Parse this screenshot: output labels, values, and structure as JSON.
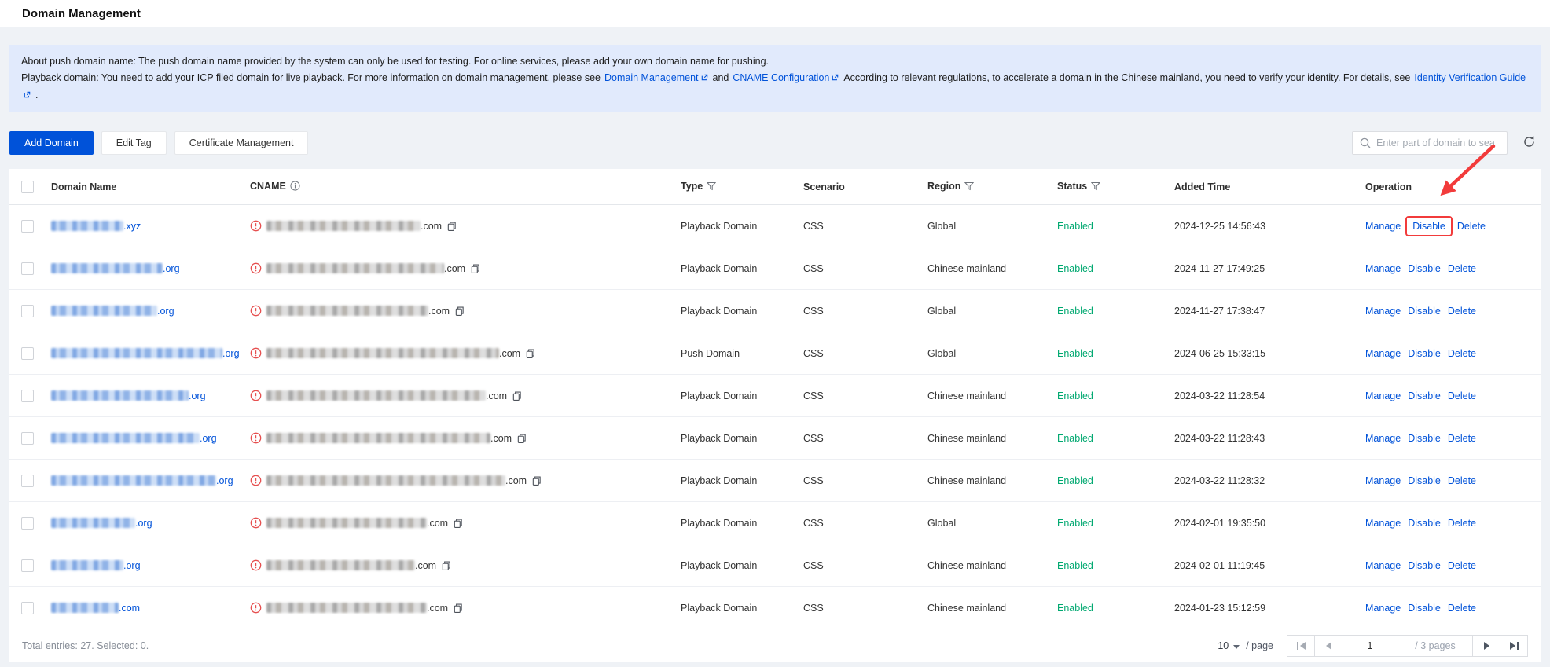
{
  "page_title": "Domain Management",
  "banner": {
    "line1": "About push domain name: The push domain name provided by the system can only be used for testing. For online services, please add your own domain name for pushing.",
    "line2_text1": "Playback domain: You need to add your ICP filed domain for live playback. For more information on domain management, please see",
    "line2_link1": "Domain Management",
    "line2_text2": "and",
    "line2_link2": "CNAME Configuration",
    "line2_text3": "According to relevant regulations, to accelerate a domain in the Chinese mainland, you need to verify your identity. For details, see",
    "line2_link3": "Identity Verification Guide",
    "line2_text4": "."
  },
  "toolbar": {
    "add_domain_label": "Add Domain",
    "edit_tag_label": "Edit Tag",
    "certificate_label": "Certificate Management",
    "search_placeholder": "Enter part of domain to sea"
  },
  "table": {
    "headers": {
      "domain": "Domain Name",
      "cname": "CNAME",
      "type": "Type",
      "scenario": "Scenario",
      "region": "Region",
      "status": "Status",
      "added": "Added Time",
      "operation": "Operation"
    },
    "op_labels": [
      "Manage",
      "Disable",
      "Delete"
    ],
    "status_color": "#00a870",
    "rows": [
      {
        "domain_suffix": ".xyz",
        "domain_blur_width": 92,
        "cname_suffix": ".com",
        "cname_blur_width": 196,
        "type": "Playback Domain",
        "scenario": "CSS",
        "region": "Global",
        "status": "Enabled",
        "added_time": "2024-12-25 14:56:43",
        "highlight_op": "Disable"
      },
      {
        "domain_suffix": ".org",
        "domain_blur_width": 142,
        "cname_suffix": ".com",
        "cname_blur_width": 226,
        "type": "Playback Domain",
        "scenario": "CSS",
        "region": "Chinese mainland",
        "status": "Enabled",
        "added_time": "2024-11-27 17:49:25",
        "highlight_op": null
      },
      {
        "domain_suffix": ".org",
        "domain_blur_width": 135,
        "cname_suffix": ".com",
        "cname_blur_width": 206,
        "type": "Playback Domain",
        "scenario": "CSS",
        "region": "Global",
        "status": "Enabled",
        "added_time": "2024-11-27 17:38:47",
        "highlight_op": null
      },
      {
        "domain_suffix": ".org",
        "domain_blur_width": 218,
        "cname_suffix": ".com",
        "cname_blur_width": 296,
        "type": "Push Domain",
        "scenario": "CSS",
        "region": "Global",
        "status": "Enabled",
        "added_time": "2024-06-25 15:33:15",
        "highlight_op": null
      },
      {
        "domain_suffix": ".org",
        "domain_blur_width": 175,
        "cname_suffix": ".com",
        "cname_blur_width": 279,
        "type": "Playback Domain",
        "scenario": "CSS",
        "region": "Chinese mainland",
        "status": "Enabled",
        "added_time": "2024-03-22 11:28:54",
        "highlight_op": null
      },
      {
        "domain_suffix": ".org",
        "domain_blur_width": 189,
        "cname_suffix": ".com",
        "cname_blur_width": 285,
        "type": "Playback Domain",
        "scenario": "CSS",
        "region": "Chinese mainland",
        "status": "Enabled",
        "added_time": "2024-03-22 11:28:43",
        "highlight_op": null
      },
      {
        "domain_suffix": ".org",
        "domain_blur_width": 210,
        "cname_suffix": ".com",
        "cname_blur_width": 304,
        "type": "Playback Domain",
        "scenario": "CSS",
        "region": "Chinese mainland",
        "status": "Enabled",
        "added_time": "2024-03-22 11:28:32",
        "highlight_op": null
      },
      {
        "domain_suffix": ".org",
        "domain_blur_width": 107,
        "cname_suffix": ".com",
        "cname_blur_width": 204,
        "type": "Playback Domain",
        "scenario": "CSS",
        "region": "Global",
        "status": "Enabled",
        "added_time": "2024-02-01 19:35:50",
        "highlight_op": null
      },
      {
        "domain_suffix": ".org",
        "domain_blur_width": 92,
        "cname_suffix": ".com",
        "cname_blur_width": 189,
        "type": "Playback Domain",
        "scenario": "CSS",
        "region": "Chinese mainland",
        "status": "Enabled",
        "added_time": "2024-02-01 11:19:45",
        "highlight_op": null
      },
      {
        "domain_suffix": ".com",
        "domain_blur_width": 86,
        "cname_suffix": ".com",
        "cname_blur_width": 204,
        "type": "Playback Domain",
        "scenario": "CSS",
        "region": "Chinese mainland",
        "status": "Enabled",
        "added_time": "2024-01-23 15:12:59",
        "highlight_op": null
      }
    ]
  },
  "footer": {
    "total_text": "Total entries: 27. Selected: 0.",
    "page_size": "10",
    "per_page_label": "/ page",
    "current_page": "1",
    "total_pages_label": "/ 3 pages"
  }
}
